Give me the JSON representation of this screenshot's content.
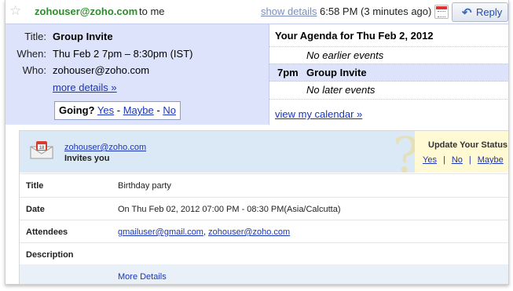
{
  "header": {
    "sender": "zohouser@zoho.com",
    "to": "to me",
    "show_details": "show details",
    "time": "6:58 PM (3 minutes ago)",
    "reply": "Reply"
  },
  "invite": {
    "title_label": "Title:",
    "title_value": "Group Invite",
    "when_label": "When:",
    "when_value": "Thu Feb 2 7pm – 8:30pm (IST)",
    "who_label": "Who:",
    "who_value": "zohouser@zoho.com",
    "more_details": "more details »",
    "going_label": "Going?",
    "yes": "Yes",
    "maybe": "Maybe",
    "no": "No",
    "sep": "-"
  },
  "agenda": {
    "title": "Your Agenda for Thu Feb 2, 2012",
    "before": "No earlier events",
    "event_time": "7pm",
    "event_title": "Group Invite",
    "after": "No later events",
    "view_calendar": "view my calendar »"
  },
  "card": {
    "user": "zohouser@zoho.com",
    "invites": "Invites you",
    "update_status": "Update Your Status",
    "yes": "Yes",
    "no": "No",
    "maybe": "Maybe",
    "link_sep": "|",
    "fields": {
      "title_label": "Title",
      "title_value": "Birthday party",
      "date_label": "Date",
      "date_value": "On Thu Feb 02, 2012 07:00 PM - 08:30 PM(Asia/Calcutta)",
      "attendees_label": "Attendees",
      "attendee_1": "gmailuser@gmail.com",
      "attendee_sep": ",",
      "attendee_2": "zohouser@zoho.com",
      "description_label": "Description",
      "description_value": ""
    },
    "more_details": "More Details"
  },
  "colors": {
    "sender_green": "#2e8b2e",
    "invite_bg": "#dde3fb",
    "link_blue": "#1a35b8",
    "card_header_bg": "#dbe9f6",
    "status_bg": "#fff9d4"
  },
  "icons": [
    "star-icon",
    "calendar-icon",
    "reply-arrow-icon",
    "invite-envelope-icon",
    "question-mark-icon"
  ]
}
